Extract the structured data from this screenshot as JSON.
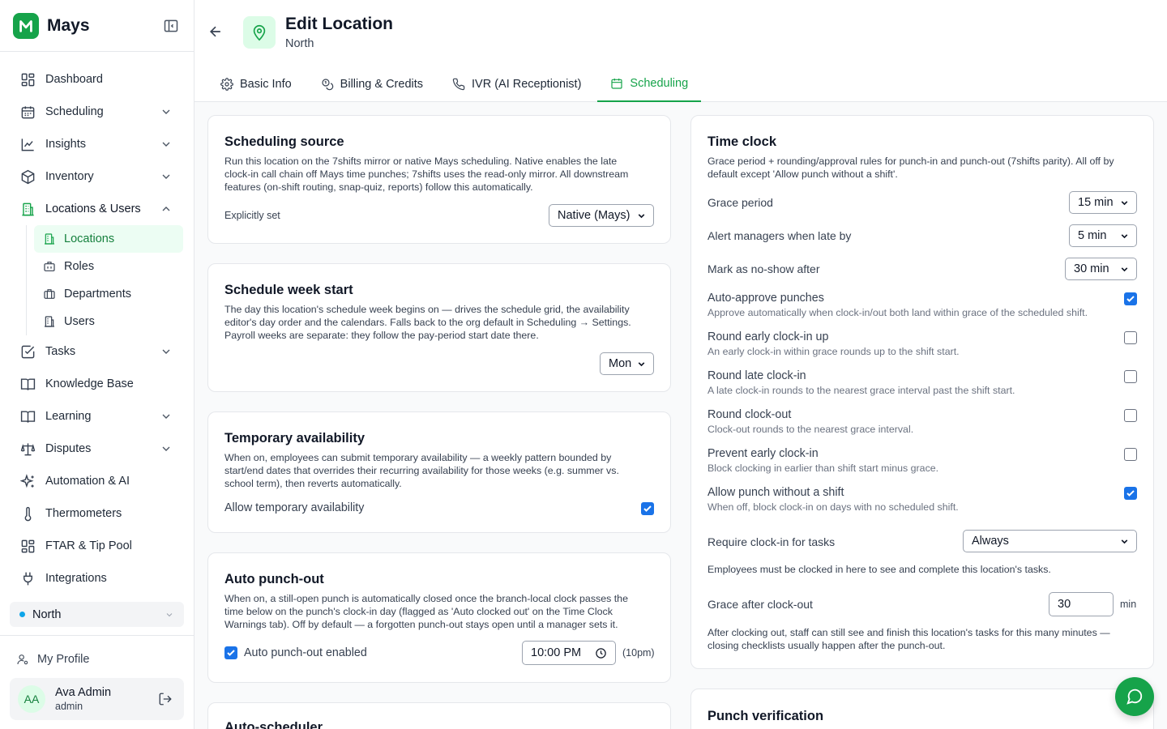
{
  "app": {
    "name": "Mays"
  },
  "sidebar": {
    "items": [
      {
        "label": "Dashboard"
      },
      {
        "label": "Scheduling"
      },
      {
        "label": "Insights"
      },
      {
        "label": "Inventory"
      },
      {
        "label": "Locations & Users"
      },
      {
        "label": "Tasks"
      },
      {
        "label": "Knowledge Base"
      },
      {
        "label": "Learning"
      },
      {
        "label": "Disputes"
      },
      {
        "label": "Automation & AI"
      },
      {
        "label": "Thermometers"
      },
      {
        "label": "FTAR & Tip Pool"
      },
      {
        "label": "Integrations"
      }
    ],
    "sub_items": [
      {
        "label": "Locations"
      },
      {
        "label": "Roles"
      },
      {
        "label": "Departments"
      },
      {
        "label": "Users"
      }
    ],
    "location_selector": "North",
    "my_profile": "My Profile",
    "user": {
      "initials": "AA",
      "name": "Ava Admin",
      "role": "admin"
    }
  },
  "header": {
    "title": "Edit Location",
    "subtitle": "North",
    "tabs": [
      {
        "label": "Basic Info"
      },
      {
        "label": "Billing & Credits"
      },
      {
        "label": "IVR (AI Receptionist)"
      },
      {
        "label": "Scheduling"
      }
    ]
  },
  "scheduling_source": {
    "title": "Scheduling source",
    "desc_lines": [
      "Run this location on the 7shifts mirror or native Mays scheduling. Native enables the late",
      "clock-in call chain off Mays time punches; 7shifts uses the read-only mirror. All downstream",
      "features (on-shift routing, snap-quiz, reports) follow this automatically."
    ],
    "label": "Explicitly set",
    "value": "Native (Mays)"
  },
  "week_start": {
    "title": "Schedule week start",
    "desc_lines": [
      "The day this location's schedule week begins on — drives the schedule grid, the availability",
      "editor's day order and the calendars. Falls back to the org default in Scheduling → Settings.",
      "Payroll weeks are separate: they follow the pay-period start date there."
    ],
    "value": "Mon"
  },
  "temp_availability": {
    "title": "Temporary availability",
    "desc_lines": [
      "When on, employees can submit temporary availability — a weekly pattern bounded by",
      "start/end dates that overrides their recurring availability for those weeks (e.g. summer vs.",
      "school term), then reverts automatically."
    ],
    "option": "Allow temporary availability",
    "checked": true
  },
  "auto_punch_out": {
    "title": "Auto punch-out",
    "desc_lines": [
      "When on, a still-open punch is automatically closed once the branch-local clock passes the",
      "time below on the punch's clock-in day (flagged as 'Auto clocked out' on the Time Clock",
      "Warnings tab). Off by default — a forgotten punch-out stays open until a manager sets it."
    ],
    "option": "Auto punch-out enabled",
    "checked": true,
    "time": "10:00 PM",
    "time_hint": "(10pm)"
  },
  "auto_scheduler": {
    "title": "Auto-scheduler"
  },
  "time_clock": {
    "title": "Time clock",
    "desc_lines": [
      "Grace period + rounding/approval rules for punch-in and punch-out (7shifts parity). All off by",
      "default except 'Allow punch without a shift'."
    ],
    "grace_period": {
      "label": "Grace period",
      "value": "15 min"
    },
    "alert_late": {
      "label": "Alert managers when late by",
      "value": "5 min"
    },
    "no_show": {
      "label": "Mark as no-show after",
      "value": "30 min"
    },
    "options": [
      {
        "label": "Auto-approve punches",
        "help": "Approve automatically when clock-in/out both land within grace of the scheduled shift.",
        "checked": true
      },
      {
        "label": "Round early clock-in up",
        "help": "An early clock-in within grace rounds up to the shift start.",
        "checked": false
      },
      {
        "label": "Round late clock-in",
        "help": "A late clock-in rounds to the nearest grace interval past the shift start.",
        "checked": false
      },
      {
        "label": "Round clock-out",
        "help": "Clock-out rounds to the nearest grace interval.",
        "checked": false
      },
      {
        "label": "Prevent early clock-in",
        "help": "Block clocking in earlier than shift start minus grace.",
        "checked": false
      },
      {
        "label": "Allow punch without a shift",
        "help": "When off, block clock-in on days with no scheduled shift.",
        "checked": true
      }
    ],
    "require_clockin": {
      "label": "Require clock-in for tasks",
      "value": "Always",
      "note": "Employees must be clocked in here to see and complete this location's tasks."
    },
    "grace_after": {
      "label": "Grace after clock-out",
      "value": "30",
      "unit": "min",
      "note_lines": [
        "After clocking out, staff can still see and finish this location's tasks for this many minutes —",
        "closing checklists usually happen after the punch-out."
      ]
    }
  },
  "punch_verification": {
    "title": "Punch verification"
  }
}
